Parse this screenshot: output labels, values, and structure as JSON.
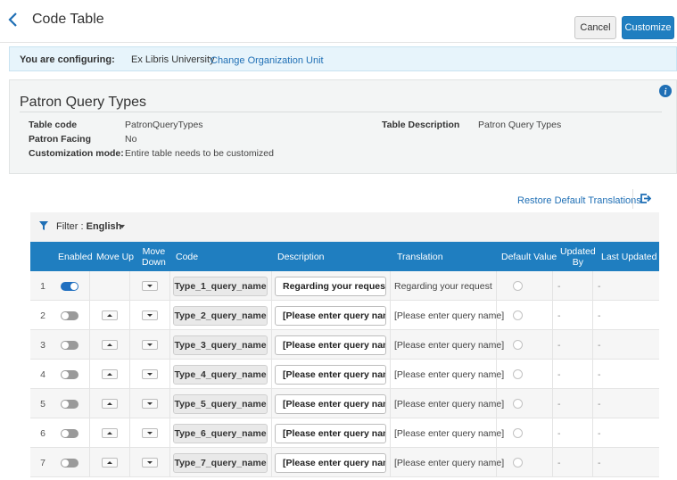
{
  "header": {
    "title": "Code Table",
    "cancel_label": "Cancel",
    "customize_label": "Customize"
  },
  "config": {
    "label": "You are configuring:",
    "organization": "Ex Libris University",
    "change_link": "Change Organization Unit"
  },
  "details": {
    "title": "Patron Query Types",
    "table_code_label": "Table code",
    "table_code_value": "PatronQueryTypes",
    "patron_facing_label": "Patron Facing",
    "patron_facing_value": "No",
    "customization_mode_label": "Customization mode:",
    "customization_mode_value": "Entire table needs to be customized",
    "table_description_label": "Table Description",
    "table_description_value": "Patron Query Types"
  },
  "toolbar": {
    "restore_label": "Restore Default Translations"
  },
  "filter": {
    "label": "Filter :",
    "value": "English"
  },
  "table": {
    "columns": {
      "enabled": "Enabled",
      "move_up": "Move Up",
      "move_down_1": "Move",
      "move_down_2": "Down",
      "code": "Code",
      "description": "Description",
      "translation": "Translation",
      "default_value": "Default Value",
      "updated_by_1": "Updated",
      "updated_by_2": "By",
      "last_updated": "Last Updated"
    },
    "rows": [
      {
        "num": "1",
        "enabled": true,
        "code": "Type_1_query_name",
        "description": "Regarding your request",
        "translation": "Regarding your request",
        "updated_by": "-",
        "last_updated": "-"
      },
      {
        "num": "2",
        "enabled": false,
        "code": "Type_2_query_name",
        "description": "[Please enter query name]",
        "translation": "[Please enter query name]",
        "updated_by": "-",
        "last_updated": "-"
      },
      {
        "num": "3",
        "enabled": false,
        "code": "Type_3_query_name",
        "description": "[Please enter query name]",
        "translation": "[Please enter query name]",
        "updated_by": "-",
        "last_updated": "-"
      },
      {
        "num": "4",
        "enabled": false,
        "code": "Type_4_query_name",
        "description": "[Please enter query name]",
        "translation": "[Please enter query name]",
        "updated_by": "-",
        "last_updated": "-"
      },
      {
        "num": "5",
        "enabled": false,
        "code": "Type_5_query_name",
        "description": "[Please enter query name]",
        "translation": "[Please enter query name]",
        "updated_by": "-",
        "last_updated": "-"
      },
      {
        "num": "6",
        "enabled": false,
        "code": "Type_6_query_name",
        "description": "[Please enter query name]",
        "translation": "[Please enter query name]",
        "updated_by": "-",
        "last_updated": "-"
      },
      {
        "num": "7",
        "enabled": false,
        "code": "Type_7_query_name",
        "description": "[Please enter query name]",
        "translation": "[Please enter query name]",
        "updated_by": "-",
        "last_updated": "-"
      }
    ]
  },
  "colors": {
    "accent": "#1f7ec0",
    "link": "#1f6fb5",
    "config_bg": "#e7f4fb"
  }
}
